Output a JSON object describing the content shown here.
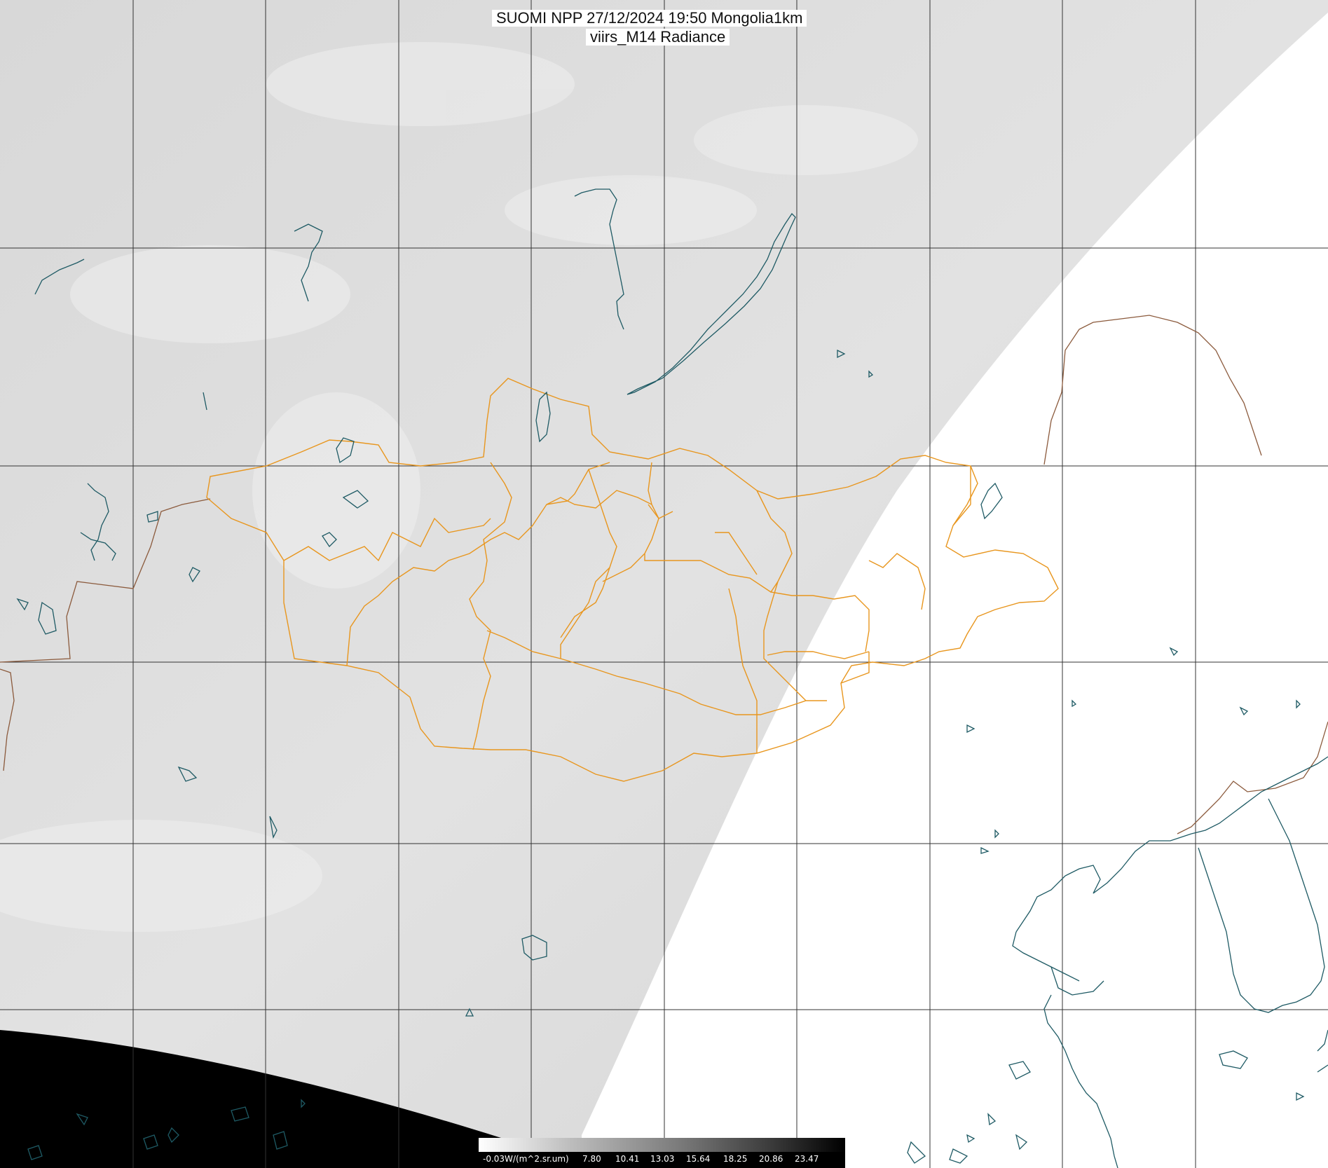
{
  "title": {
    "line1": "SUOMI NPP 27/12/2024 19:50 Mongolia1km",
    "line2": "viirs_M14 Radiance"
  },
  "colorbar": {
    "labels": [
      "-0.03W/(m^2.sr.um)",
      "7.80",
      "10.41",
      "13.03",
      "15.64",
      "18.25",
      "20.86",
      "23.47"
    ],
    "colors": [
      "#ffffff",
      "#000000"
    ]
  },
  "map": {
    "colors": {
      "swath": "#dcdcdc",
      "no_data_fill": "#000000",
      "background": "#ffffff",
      "grid": "#333333",
      "admin_borders": "#e8961e",
      "country_borders": "#8b5a3c",
      "coast_and_lakes": "#1e5a64"
    }
  }
}
